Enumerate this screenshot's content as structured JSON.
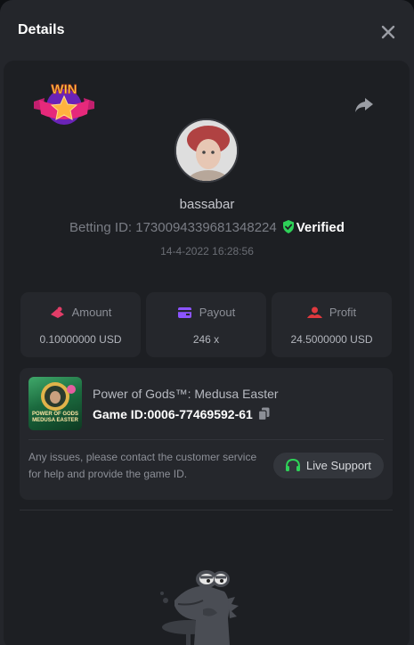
{
  "header": {
    "title": "Details"
  },
  "icons": {
    "close": "close-icon",
    "share": "share-arrow-icon",
    "badge": "win-star-badge",
    "verified": "shield-check-icon",
    "copy": "copy-icon",
    "headset": "headset-icon"
  },
  "user": {
    "name": "bassabar",
    "betting_id": "Betting ID: 1730094339681348224",
    "verified_label": "Verified",
    "date": "14-4-2022 16:28:56"
  },
  "stats": [
    {
      "label": "Amount",
      "value": "0.10000000 USD"
    },
    {
      "label": "Payout",
      "value": "246 x"
    },
    {
      "label": "Profit",
      "value": "24.5000000 USD"
    }
  ],
  "game": {
    "name": "Power of Gods™: Medusa Easter",
    "id_label": "Game ID:",
    "id_value": "0006-77469592-61",
    "thumb_text": "POWER OF GODS MEDUSA EASTER",
    "issue_text": "Any issues, please contact the customer service for help and provide the game ID.",
    "support_label": "Live Support"
  },
  "badge_text": "WIN",
  "colors": {
    "background": "#24262b",
    "card": "#1d1f23",
    "tile": "#25272c",
    "accent_green": "#2ed158",
    "amount_icon": "#e23d68",
    "payout_icon": "#8c54ff",
    "profit_icon": "#e0393e"
  }
}
